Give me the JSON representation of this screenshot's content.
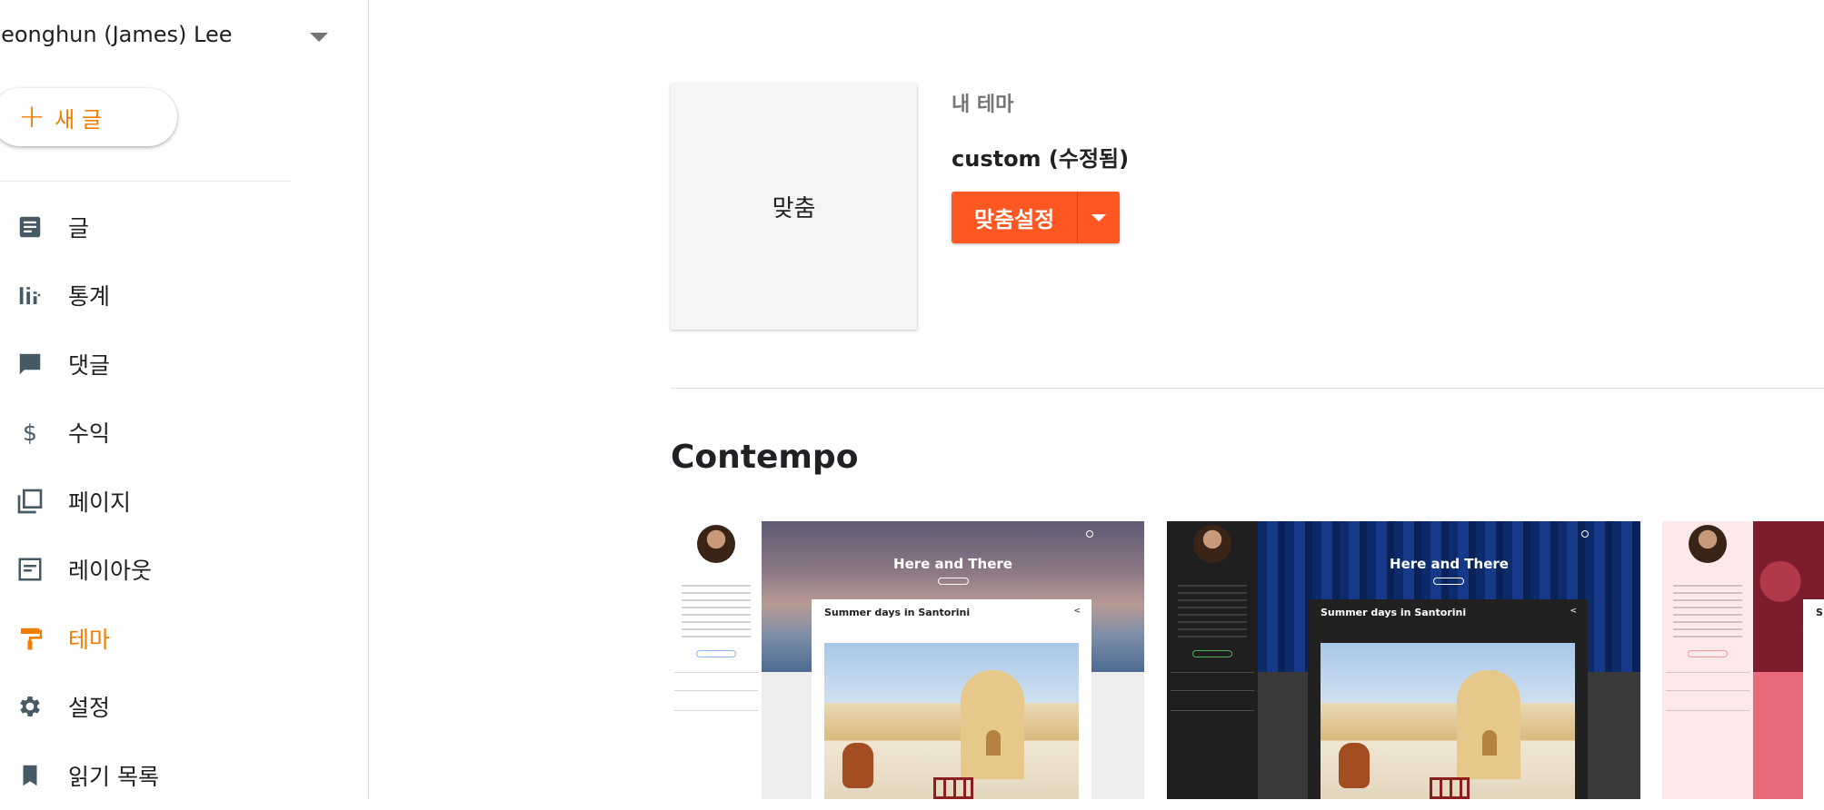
{
  "sidebar": {
    "account_name": "Jeonghun (James) Lee",
    "new_post_label": "새 글",
    "items": [
      {
        "label": "글",
        "icon": "posts-icon"
      },
      {
        "label": "통계",
        "icon": "stats-icon"
      },
      {
        "label": "댓글",
        "icon": "comments-icon"
      },
      {
        "label": "수익",
        "icon": "dollar-icon"
      },
      {
        "label": "페이지",
        "icon": "pages-icon"
      },
      {
        "label": "레이아웃",
        "icon": "layout-icon"
      },
      {
        "label": "테마",
        "icon": "paint-roller-icon",
        "active": true
      },
      {
        "label": "설정",
        "icon": "gear-icon"
      },
      {
        "label": "읽기 목록",
        "icon": "bookmark-icon"
      }
    ]
  },
  "my_theme": {
    "thumbnail_label": "맞춤",
    "section_label": "내 테마",
    "name": "custom (수정됨)",
    "customize_label": "맞춤설정"
  },
  "gallery": {
    "title": "Contempo",
    "cards": [
      {
        "blog_title": "Here and There",
        "post_title": "Summer days in Santorini",
        "variant": "light"
      },
      {
        "blog_title": "Here and There",
        "post_title": "Summer days in Santorini",
        "variant": "dark"
      },
      {
        "blog_title": "",
        "post_title": "S",
        "variant": "pink"
      }
    ]
  },
  "colors": {
    "accent": "#f57c00",
    "button": "#ff5722"
  }
}
